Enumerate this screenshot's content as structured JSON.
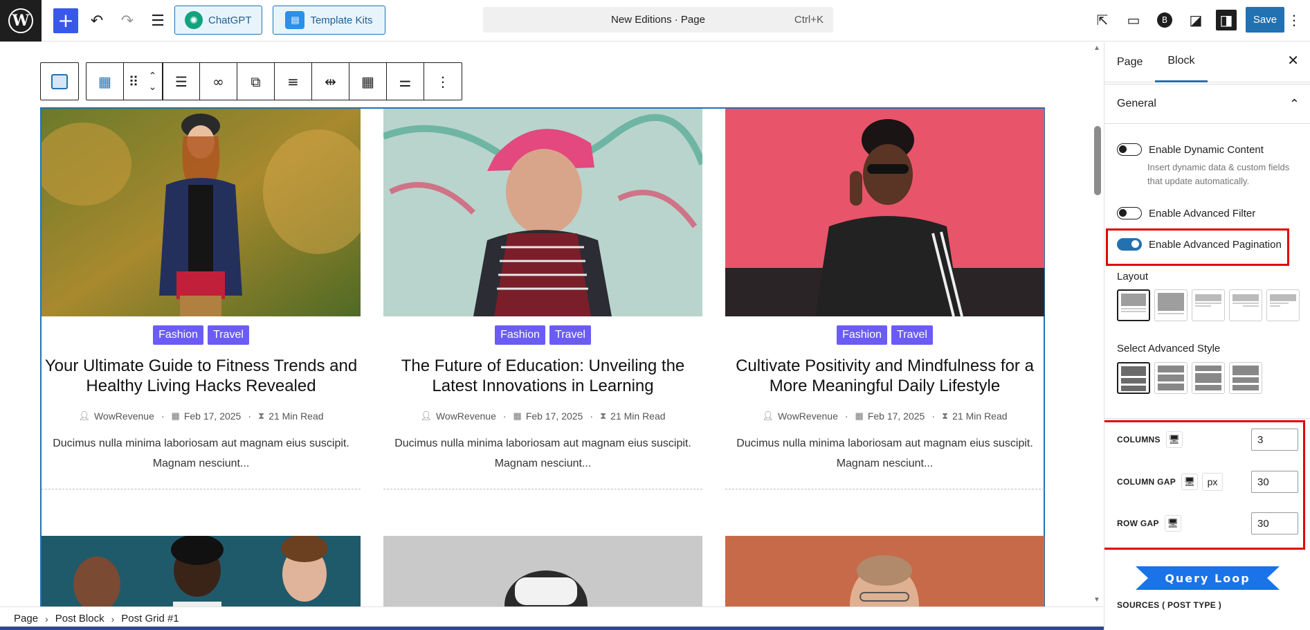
{
  "topbar": {
    "chatgpt_label": "ChatGPT",
    "template_kits_label": "Template Kits",
    "command_title": "New Editions · Page",
    "command_shortcut": "Ctrl+K",
    "save_label": "Save"
  },
  "posts": [
    {
      "tags": [
        "Fashion",
        "Travel"
      ],
      "title": "Your Ultimate Guide to Fitness Trends and Healthy Living Hacks Revealed",
      "author": "WowRevenue",
      "date": "Feb 17, 2025",
      "read_time": "21 Min Read",
      "excerpt": "Ducimus nulla minima laboriosam aut magnam eius suscipit. Magnam nesciunt..."
    },
    {
      "tags": [
        "Fashion",
        "Travel"
      ],
      "title": "The Future of Education: Unveiling the Latest Innovations in Learning",
      "author": "WowRevenue",
      "date": "Feb 17, 2025",
      "read_time": "21 Min Read",
      "excerpt": "Ducimus nulla minima laboriosam aut magnam eius suscipit. Magnam nesciunt..."
    },
    {
      "tags": [
        "Fashion",
        "Travel"
      ],
      "title": "Cultivate Positivity and Mindfulness for a More Meaningful Daily Lifestyle",
      "author": "WowRevenue",
      "date": "Feb 17, 2025",
      "read_time": "21 Min Read",
      "excerpt": "Ducimus nulla minima laboriosam aut magnam eius suscipit. Magnam nesciunt..."
    }
  ],
  "breadcrumb": [
    "Page",
    "Post Block",
    "Post Grid #1"
  ],
  "sidebar": {
    "tabs": [
      "Page",
      "Block"
    ],
    "active_tab": "Block",
    "general_label": "General",
    "toggles": [
      {
        "label": "Enable Dynamic Content",
        "on": false,
        "help": "Insert dynamic data & custom fields that update automatically."
      },
      {
        "label": "Enable Advanced Filter",
        "on": false
      },
      {
        "label": "Enable Advanced Pagination",
        "on": true
      }
    ],
    "layout_label": "Layout",
    "advanced_style_label": "Select Advanced Style",
    "columns_label": "COLUMNS",
    "columns_value": "3",
    "column_gap_label": "COLUMN GAP",
    "column_gap_unit": "px",
    "column_gap_value": "30",
    "row_gap_label": "ROW GAP",
    "row_gap_value": "30",
    "banner_text": "Query Loop",
    "sources_label": "SOURCES ( POST TYPE )"
  },
  "colors": {
    "accent": "#2271b1",
    "tag": "#6b5cf5",
    "highlight": "#e10000",
    "banner": "#1a73e8"
  }
}
